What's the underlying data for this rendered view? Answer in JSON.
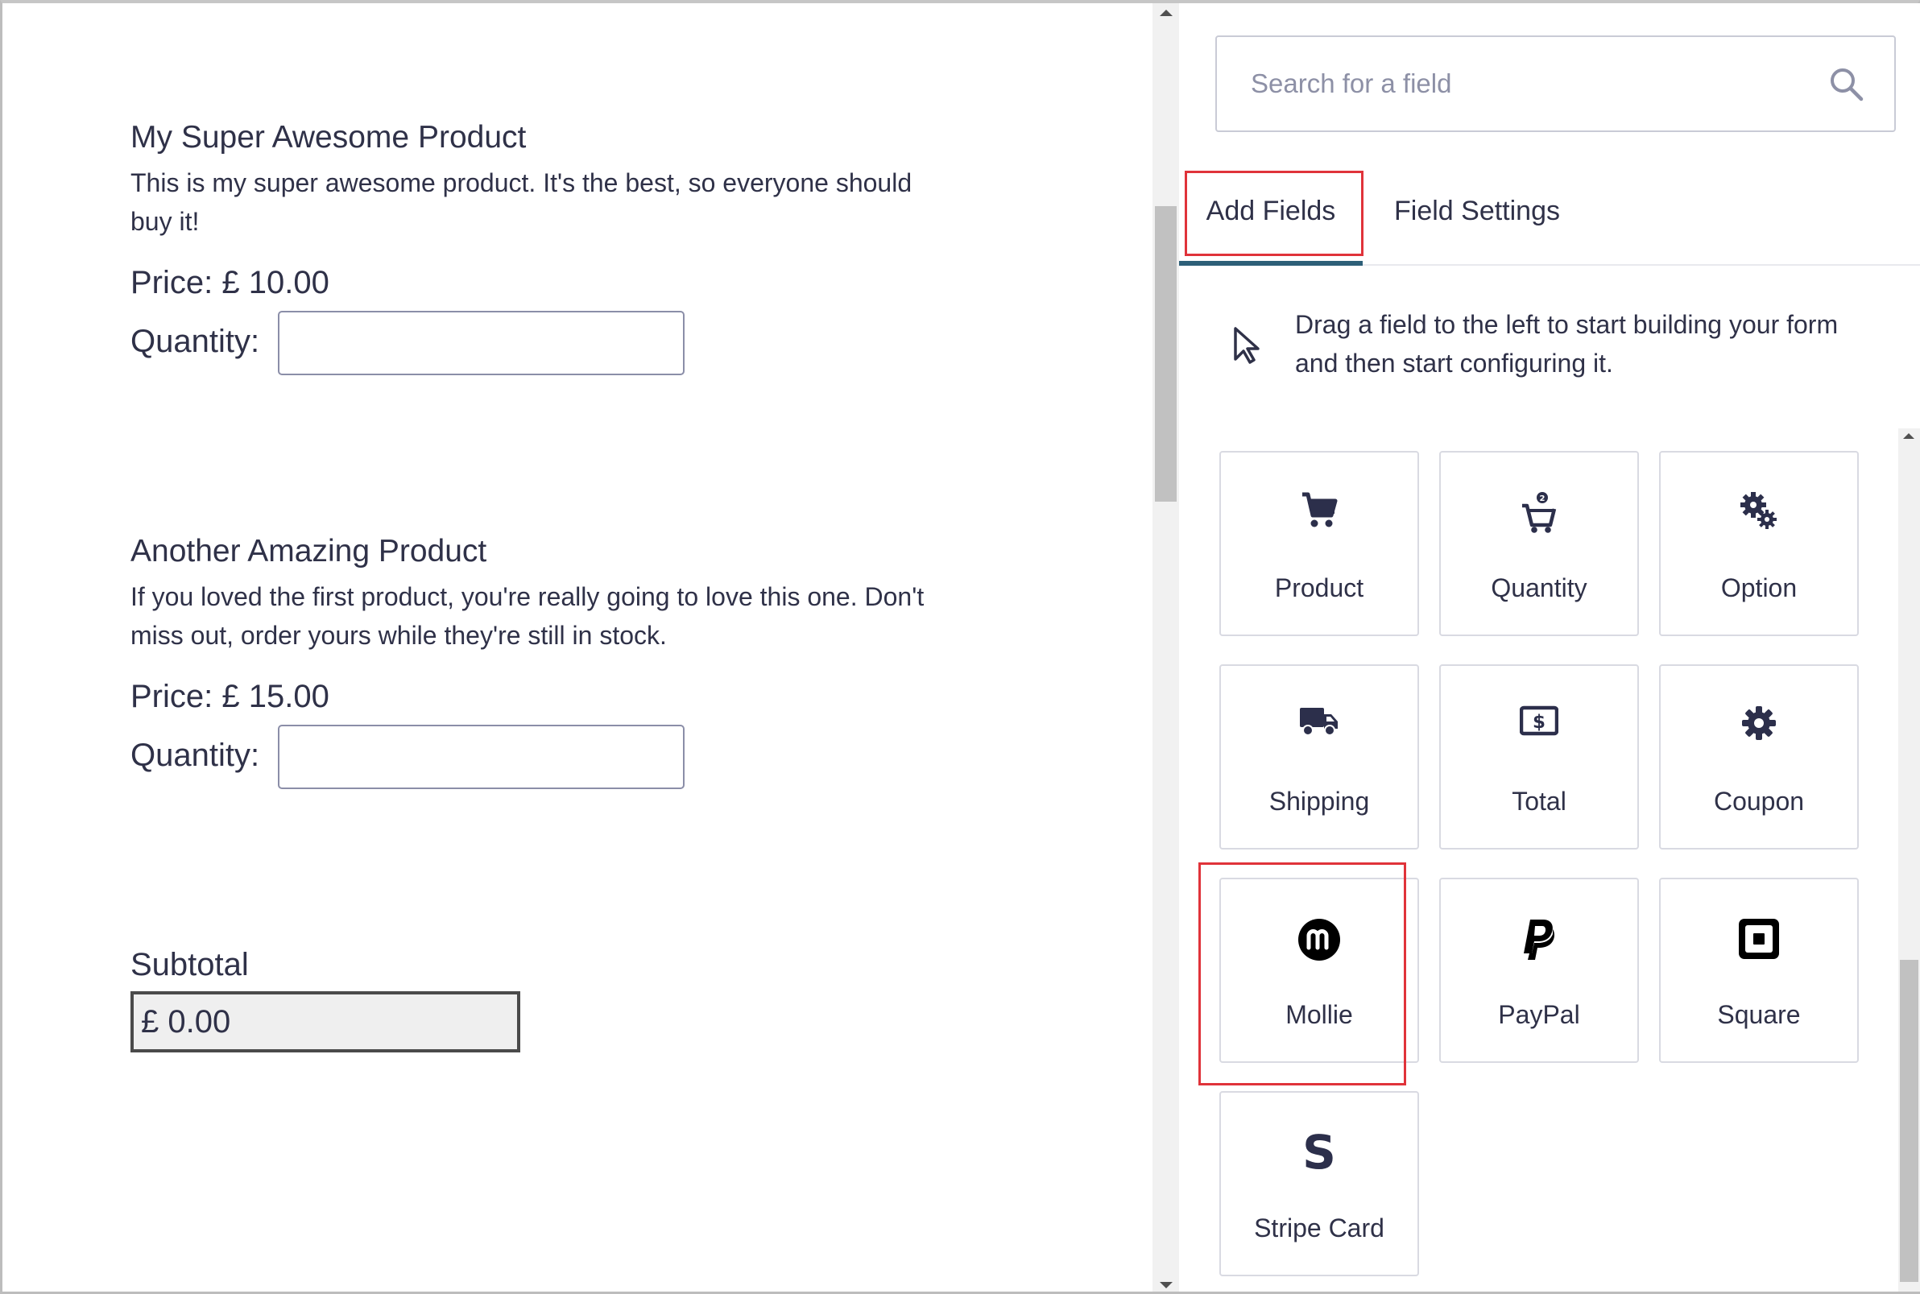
{
  "preview": {
    "products": [
      {
        "title": "My Super Awesome Product",
        "description": "This is my super awesome product. It's the best, so everyone should buy it!",
        "price": "Price: £ 10.00",
        "quantity_label": "Quantity:",
        "quantity_value": ""
      },
      {
        "title": "Another Amazing Product",
        "description": "If you loved the first product, you're really going to love this one. Don't miss out, order yours while they're still in stock.",
        "price": "Price: £ 15.00",
        "quantity_label": "Quantity:",
        "quantity_value": ""
      }
    ],
    "subtotal_label": "Subtotal",
    "subtotal_value": "£ 0.00"
  },
  "panel": {
    "search": {
      "placeholder": "Search for a field",
      "value": "",
      "icon": "search-icon"
    },
    "tabs": [
      {
        "label": "Add Fields",
        "active": true
      },
      {
        "label": "Field Settings",
        "active": false
      }
    ],
    "hint": "Drag a field to the left to start building your form and then start configuring it.",
    "fields": [
      {
        "label": "Product",
        "icon": "cart-icon"
      },
      {
        "label": "Quantity",
        "icon": "cart-quantity-icon"
      },
      {
        "label": "Option",
        "icon": "gears-icon"
      },
      {
        "label": "Shipping",
        "icon": "truck-icon"
      },
      {
        "label": "Total",
        "icon": "money-bill-icon"
      },
      {
        "label": "Coupon",
        "icon": "gear-icon"
      },
      {
        "label": "Mollie",
        "icon": "mollie-icon"
      },
      {
        "label": "PayPal",
        "icon": "paypal-icon"
      },
      {
        "label": "Square",
        "icon": "square-icon"
      },
      {
        "label": "Stripe Card",
        "icon": "stripe-icon"
      }
    ]
  },
  "colors": {
    "text": "#2f3148",
    "highlight": "#e0333a",
    "active_tab_underline": "#2d5f78",
    "tile_border": "#d9dae2"
  }
}
